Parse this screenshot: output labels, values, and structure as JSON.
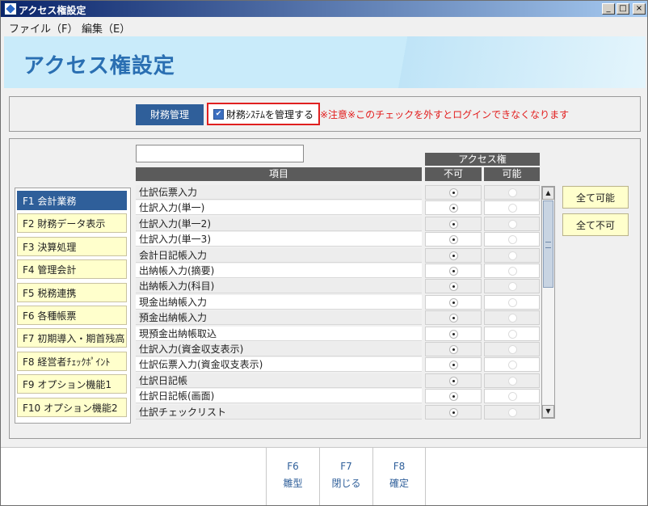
{
  "window": {
    "title": "アクセス権設定",
    "controls": [
      "_",
      "□",
      "×"
    ]
  },
  "menu": {
    "items": [
      "ファイル（F）",
      "編集（E）"
    ]
  },
  "header": {
    "title": "アクセス権設定"
  },
  "top": {
    "section_button": "財務管理",
    "checkbox_label": "財務ｼｽﾃﾑを管理する",
    "checkbox_checked": true,
    "warning": "※注意※このチェックを外すとログインできなくなります"
  },
  "table": {
    "search_value": "",
    "access_header": "アクセス権",
    "col_item": "項目",
    "col_no": "不可",
    "col_ok": "可能",
    "rows": [
      {
        "name": "仕訳伝票入力",
        "value": "不可"
      },
      {
        "name": "仕訳入力(単一)",
        "value": "不可"
      },
      {
        "name": "仕訳入力(単一2)",
        "value": "不可"
      },
      {
        "name": "仕訳入力(単一3)",
        "value": "不可"
      },
      {
        "name": "会計日記帳入力",
        "value": "不可"
      },
      {
        "name": "出納帳入力(摘要)",
        "value": "不可"
      },
      {
        "name": "出納帳入力(科目)",
        "value": "不可"
      },
      {
        "name": "現金出納帳入力",
        "value": "不可"
      },
      {
        "name": "預金出納帳入力",
        "value": "不可"
      },
      {
        "name": "現預金出納帳取込",
        "value": "不可"
      },
      {
        "name": "仕訳入力(資金収支表示)",
        "value": "不可"
      },
      {
        "name": "仕訳伝票入力(資金収支表示)",
        "value": "不可"
      },
      {
        "name": "仕訳日記帳",
        "value": "不可"
      },
      {
        "name": "仕訳日記帳(画面)",
        "value": "不可"
      },
      {
        "name": "仕訳チェックリスト",
        "value": "不可"
      }
    ]
  },
  "categories": [
    {
      "label": "F1 会計業務",
      "active": true
    },
    {
      "label": "F2 財務データ表示",
      "active": false
    },
    {
      "label": "F3 決算処理",
      "active": false
    },
    {
      "label": "F4 管理会計",
      "active": false
    },
    {
      "label": "F5 税務連携",
      "active": false
    },
    {
      "label": "F6 各種帳票",
      "active": false
    },
    {
      "label": "F7 初期導入・期首残高",
      "active": false
    },
    {
      "label": "F8 経営者ﾁｪｯｸﾎﾟｲﾝﾄ",
      "active": false
    },
    {
      "label": "F9 オプション機能1",
      "active": false
    },
    {
      "label": "F10 オプション機能2",
      "active": false
    }
  ],
  "actions": {
    "all_ok": "全て可能",
    "all_no": "全て不可"
  },
  "footer": {
    "keys": [
      {
        "key": "F6",
        "label": "雛型"
      },
      {
        "key": "F7",
        "label": "閉じる"
      },
      {
        "key": "F8",
        "label": "確定"
      }
    ]
  }
}
